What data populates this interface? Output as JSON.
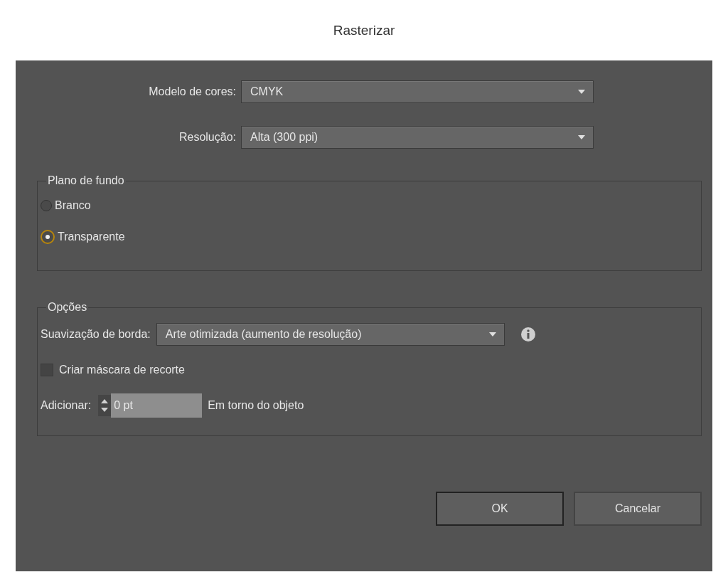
{
  "window": {
    "title": "Rasterizar"
  },
  "fields": [
    {
      "label": "Modelo de cores:",
      "value": "CMYK"
    },
    {
      "label": "Resolução:",
      "value": "Alta (300 ppi)"
    }
  ],
  "background": {
    "title": "Plano de fundo",
    "options": [
      {
        "label": "Branco",
        "selected": false
      },
      {
        "label": "Transparente",
        "selected": true
      }
    ]
  },
  "options": {
    "title": "Opções",
    "antialias": {
      "label": "Suavização de borda:",
      "value": "Arte otimizada (aumento de resolução)"
    },
    "clipping_mask": {
      "label": "Criar máscara de recorte",
      "checked": false
    },
    "add": {
      "label": "Adicionar:",
      "value": "0 pt",
      "suffix": "Em torno do objeto"
    }
  },
  "buttons": [
    {
      "label": "OK",
      "default": true
    },
    {
      "label": "Cancelar",
      "default": false
    }
  ]
}
